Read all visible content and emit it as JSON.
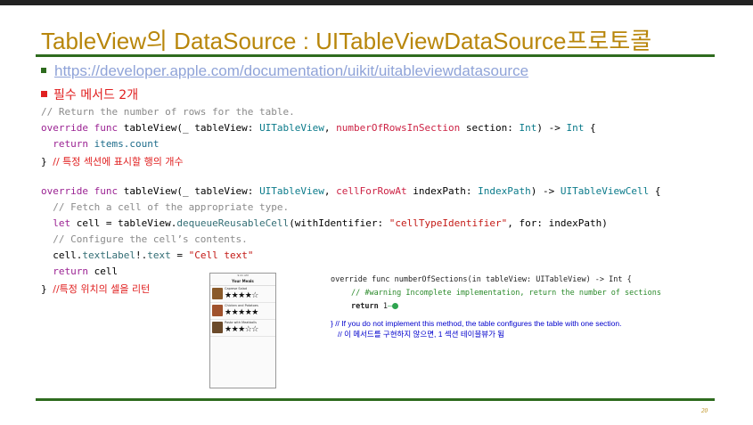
{
  "slide": {
    "title": "TableView의 DataSource : UITableViewDataSource프로토콜",
    "link": "https://developer.apple.com/documentation/uikit/uitableviewdatasource",
    "required_methods": "필수 메서드 2개",
    "page_number": "20",
    "colors": {
      "title": "#b8860b",
      "rule": "#2e6b1e",
      "bullet_red": "#e02020",
      "link": "#8fa3d8",
      "note": "#0000cc"
    }
  },
  "code1": {
    "c1": "// Return the number of rows for the table.",
    "l2_override": "override",
    "l2_func": "func",
    "l2_name": " tableView(_ tableView: ",
    "l2_type1": "UITableView",
    "l2_comma": ", ",
    "l2_arg": "numberOfRowsInSection",
    "l2_sec": " section: ",
    "l2_int": "Int",
    "l2_arrow": ") -> ",
    "l2_ret": "Int",
    "l2_brace": " {",
    "l3_return": "return",
    "l3_val": " items.count",
    "l4_brace": "} ",
    "l4_comment": "// 특정 섹션에 표시할 행의 개수"
  },
  "code2": {
    "l1_override": "override",
    "l1_func": "func",
    "l1_name": " tableView(_ tableView: ",
    "l1_type1": "UITableView",
    "l1_comma": ", ",
    "l1_arg": "cellForRowAt",
    "l1_ip": " indexPath: ",
    "l1_type2": "IndexPath",
    "l1_arrow": ") -> ",
    "l1_ret": "UITableViewCell",
    "l1_brace": " {",
    "c2": "  // Fetch a cell of the appropriate type.",
    "l3_let": "let",
    "l3_cell": " cell = tableView.",
    "l3_fn": "dequeueReusableCell",
    "l3_with": "(withIdentifier: ",
    "l3_str": "\"cellTypeIdentifier\"",
    "l3_for": ", for: indexPath)",
    "c4": "  // Configure the cell’s contents.",
    "l5_a": "cell.",
    "l5_label": "textLabel",
    "l5_b": "!.",
    "l5_text": "text",
    "l5_c": " = ",
    "l5_str": "\"Cell text\"",
    "l6_return": "return",
    "l6_val": " cell",
    "l7_brace": "} ",
    "l7_comment": "//특정 위치의 셀을 리턴"
  },
  "phone": {
    "status": "9:41 AM",
    "title": "Your Meals",
    "cells": [
      {
        "name": "Caprese Salad",
        "stars": "★★★★☆"
      },
      {
        "name": "Chicken and Potatoes",
        "stars": "★★★★★"
      },
      {
        "name": "Pasta with Meatballs",
        "stars": "★★★☆☆"
      }
    ]
  },
  "snippet": {
    "l1": "override func numberOfSections(in tableView: UITableView) -> Int {",
    "l2": "// #warning Incomplete implementation, return the number of sections",
    "l3_return": "return",
    "l3_val": " 1",
    "note1": "} // If you do not implement this method, the table configures the table with one section.",
    "note2": "// 이 메서드를 구현하지 않으면, 1 섹션 테이블뷰가 됨"
  }
}
